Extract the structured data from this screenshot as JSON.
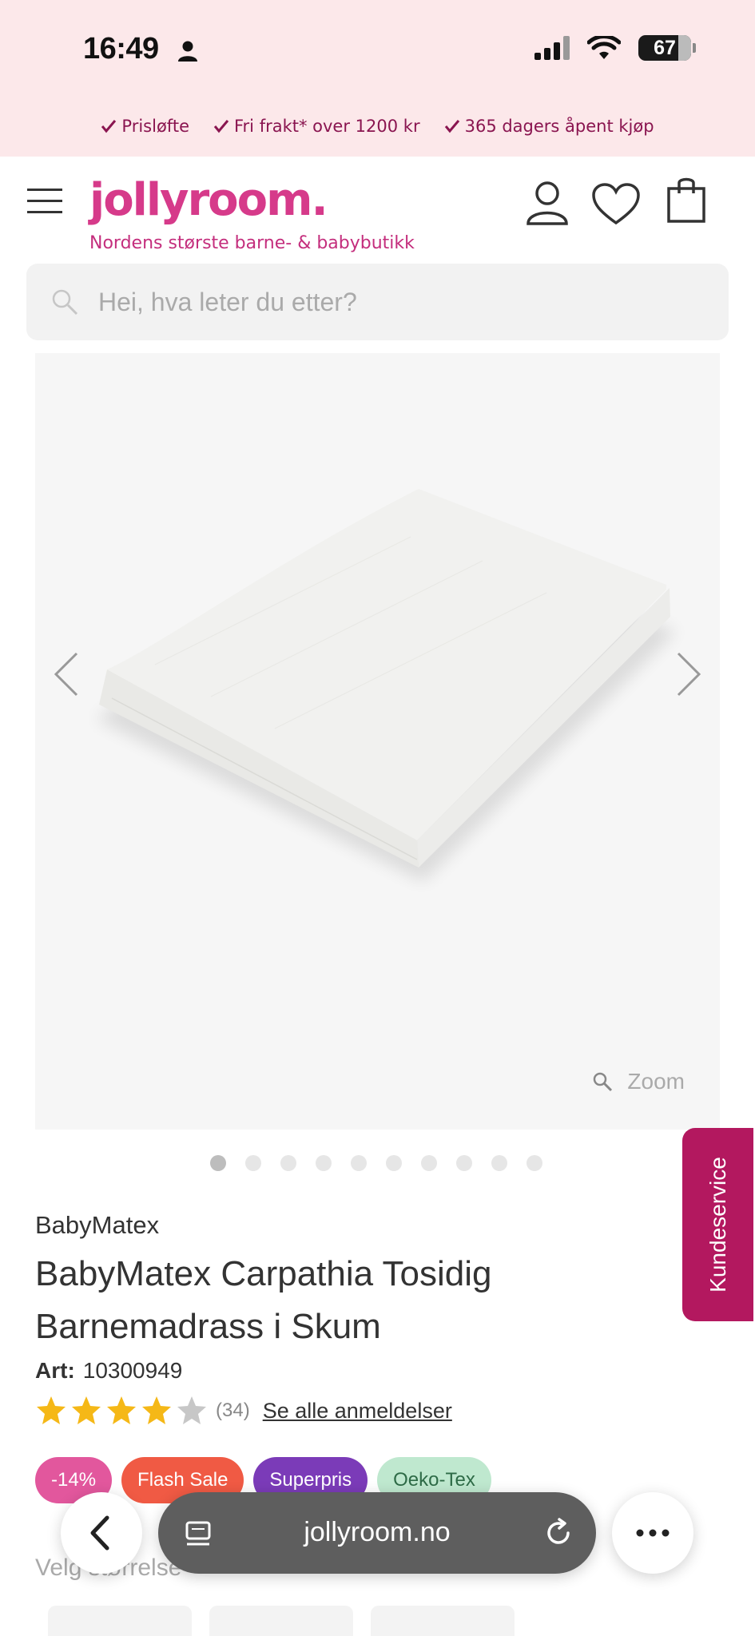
{
  "status_bar": {
    "time": "16:49",
    "battery": "67"
  },
  "usp": [
    "Prisløfte",
    "Fri frakt* over 1200 kr",
    "365 dagers åpent kjøp"
  ],
  "header": {
    "logo": "jollyroom.",
    "tagline": "Nordens største barne- & babybutikk"
  },
  "search": {
    "placeholder": "Hei, hva leter du etter?"
  },
  "gallery": {
    "zoom_label": "Zoom",
    "dot_count": 10,
    "active_index": 0
  },
  "kundeservice": "Kundeservice",
  "product": {
    "brand": "BabyMatex",
    "title": "BabyMatex Carpathia Tosidig Barnemadrass i Skum",
    "art_label": "Art:",
    "art_number": "10300949",
    "rating": 4,
    "review_count": "(34)",
    "reviews_link": "Se alle anmeldelser",
    "badges": [
      {
        "label": "-14%",
        "color": "#e2579d"
      },
      {
        "label": "Flash Sale",
        "color": "#f05a44"
      },
      {
        "label": "Superpris",
        "color": "#7b3bb8"
      },
      {
        "label": "Oeko-Tex",
        "color": "#bfe8cf",
        "text_color": "#2e6b47"
      }
    ],
    "size_label": "Velg størrelse"
  },
  "browser": {
    "url": "jollyroom.no"
  },
  "colors": {
    "brand_pink": "#d63a8a",
    "accent_magenta": "#b3185f",
    "usp_bg": "#fce8ea"
  }
}
